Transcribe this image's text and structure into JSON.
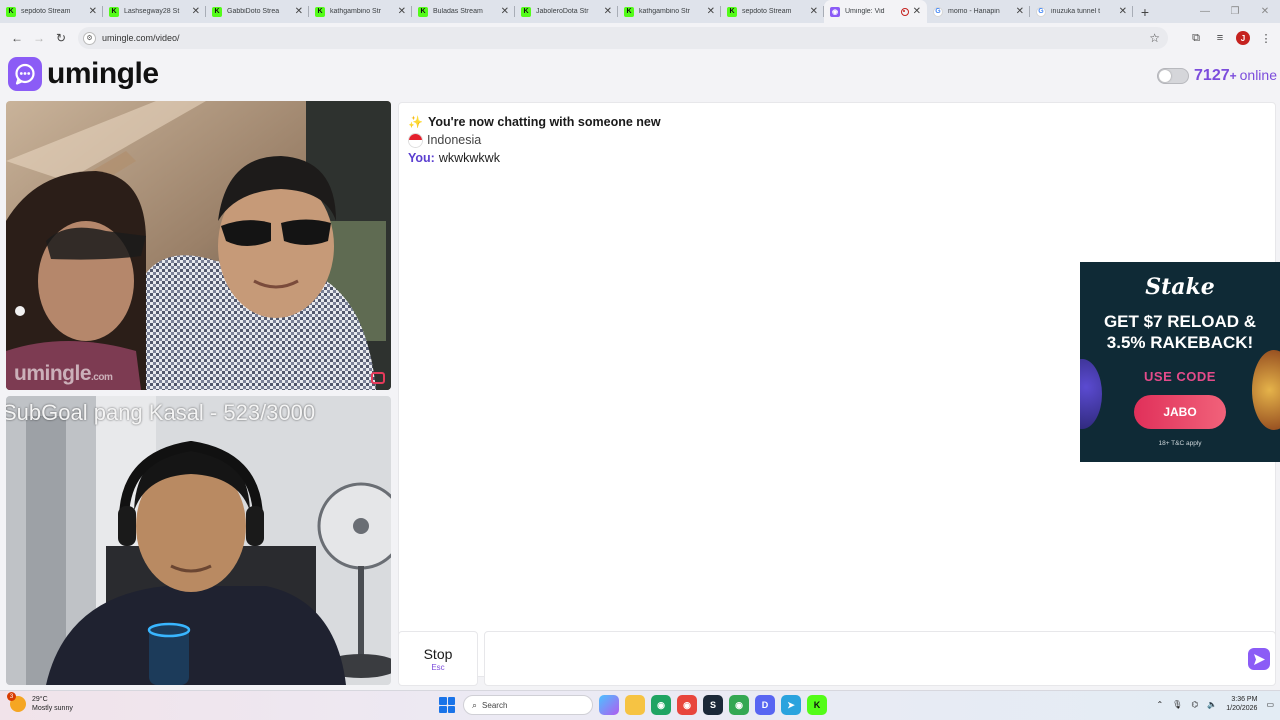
{
  "browser": {
    "tabs": [
      {
        "title": "sepdoto Stream",
        "icon": "kick-icon"
      },
      {
        "title": "Lashsegway28 St",
        "icon": "kick-icon"
      },
      {
        "title": "GabbiDoto Strea",
        "icon": "kick-icon"
      },
      {
        "title": "kathgambino Str",
        "icon": "kick-icon"
      },
      {
        "title": "Buladas Stream",
        "icon": "kick-icon"
      },
      {
        "title": "JaboleroDota Str",
        "icon": "kick-icon"
      },
      {
        "title": "kathgambino Str",
        "icon": "kick-icon"
      },
      {
        "title": "sepdoto Stream",
        "icon": "kick-icon"
      },
      {
        "title": "Umingle: Vid",
        "icon": "umingle-icon",
        "active": true
      },
      {
        "title": "momo - Hanapin",
        "icon": "google-icon"
      },
      {
        "title": "inuzuka tunnel t",
        "icon": "google-icon"
      }
    ],
    "url": "umingle.com/video/",
    "profile_initial": "J"
  },
  "page": {
    "logo_text": "umingle",
    "online_count": "7127",
    "online_plus": "+",
    "online_label": "online"
  },
  "videos": {
    "top_watermark": "umingle",
    "top_watermark_suffix": ".com",
    "bottom_overlay": "SubGoal pang Kasal - 523/3000"
  },
  "chat": {
    "system_message": "You're now chatting with someone new",
    "country": "Indonesia",
    "you_label": "You:",
    "you_message": "wkwkwkwk"
  },
  "ad": {
    "brand": "Stake",
    "headline_1": "GET $7 RELOAD &",
    "headline_2": "3.5% RAKEBACK!",
    "use_code": "USE CODE",
    "code": "JABO",
    "fine_print": "18+ T&C apply"
  },
  "controls": {
    "stop_label": "Stop",
    "stop_key": "Esc",
    "message_placeholder": ""
  },
  "taskbar": {
    "weather_badge": "3",
    "temperature": "29°C",
    "condition": "Mostly sunny",
    "search_label": "Search",
    "time": "3:36 PM",
    "date": "1/20/2026"
  },
  "colors": {
    "accent": "#8b5cf6",
    "accent_text": "#7c4ddc",
    "you_label": "#5b3fd0",
    "ad_bg": "#0f2a36",
    "ad_pink": "#e44b8a"
  }
}
